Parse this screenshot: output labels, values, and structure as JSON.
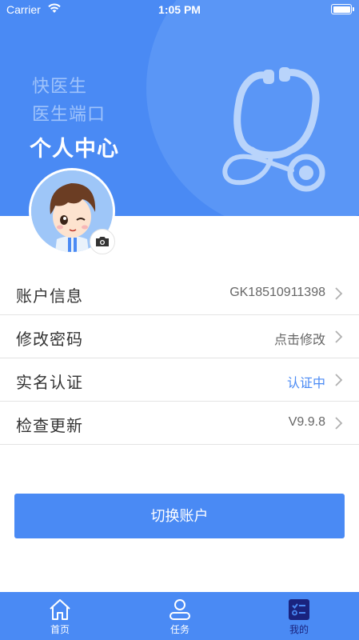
{
  "status_bar": {
    "carrier": "Carrier",
    "time": "1:05 PM"
  },
  "header": {
    "app_name": "快医生",
    "app_sub": "医生端口",
    "title": "个人中心"
  },
  "menu": [
    {
      "label": "账户信息",
      "value": "GK18510911398",
      "value_color": "#666666"
    },
    {
      "label": "修改密码",
      "value": "点击修改",
      "value_color": "#666666"
    },
    {
      "label": "实名认证",
      "value": "认证中",
      "value_color": "#4a8af4"
    },
    {
      "label": "检查更新",
      "value": "V9.9.8",
      "value_color": "#666666"
    }
  ],
  "switch_button": "切换账户",
  "tabs": [
    {
      "label": "首页",
      "icon": "home-icon"
    },
    {
      "label": "任务",
      "icon": "person-icon"
    },
    {
      "label": "我的",
      "icon": "checklist-icon",
      "active": true
    }
  ],
  "colors": {
    "primary": "#4a8af4",
    "tab_active": "#1a237e"
  }
}
